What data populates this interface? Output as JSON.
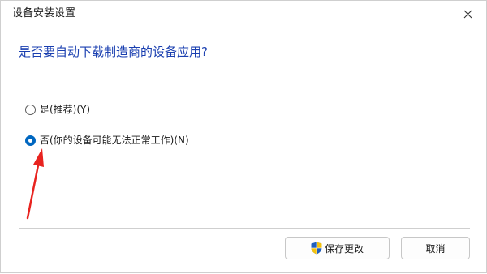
{
  "window": {
    "title": "设备安装设置"
  },
  "question": "是否要自动下载制造商的设备应用?",
  "options": [
    {
      "label": "是(推荐)(Y)",
      "selected": false
    },
    {
      "label": "否(你的设备可能无法正常工作)(N)",
      "selected": true
    }
  ],
  "buttons": {
    "save_label": "保存更改",
    "cancel_label": "取消"
  },
  "icons": {
    "close": "close-icon",
    "shield": "uac-shield-icon",
    "annotation": "red-arrow"
  },
  "colors": {
    "accent": "#0067c0",
    "heading": "#1a3fb0",
    "annotation": "#e8231f"
  }
}
